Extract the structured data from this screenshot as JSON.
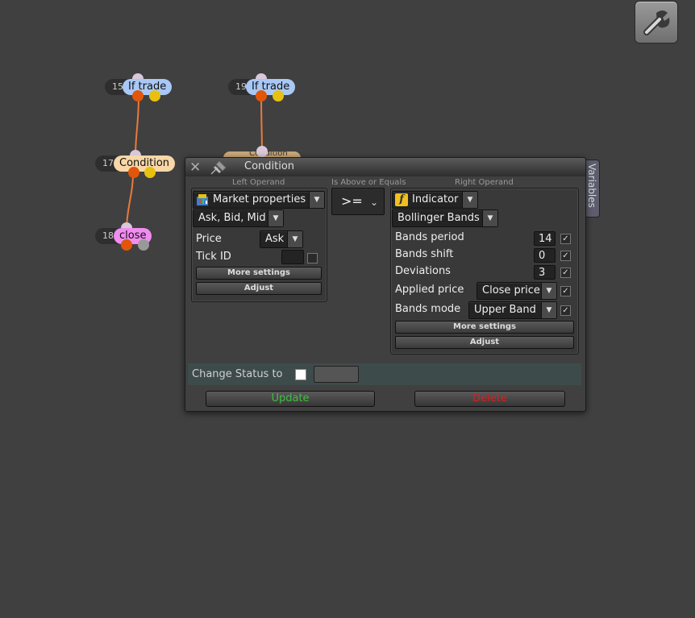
{
  "nodes": [
    {
      "id": "15",
      "label": "If trade"
    },
    {
      "id": "19",
      "label": "If trade"
    },
    {
      "id": "17",
      "label": "Condition"
    },
    {
      "id": "18",
      "label": "close"
    }
  ],
  "hidden_node_label": "Condition",
  "dialog": {
    "title": "Condition",
    "variables_tab": "Variables",
    "left": {
      "caption": "Left Operand",
      "type": "Market properties",
      "subtype": "Ask, Bid, Mid",
      "params": [
        {
          "label": "Price",
          "value": "Ask"
        },
        {
          "label": "Tick ID",
          "value": ""
        }
      ],
      "more_settings": "More settings",
      "adjust": "Adjust"
    },
    "operator": {
      "caption": "Is Above or Equals",
      "value": ">="
    },
    "right": {
      "caption": "Right Operand",
      "type": "Indicator",
      "subtype": "Bollinger Bands",
      "params": [
        {
          "label": "Bands period",
          "value": "14"
        },
        {
          "label": "Bands shift",
          "value": "0"
        },
        {
          "label": "Deviations",
          "value": "3"
        },
        {
          "label": "Applied price",
          "value": "Close price"
        },
        {
          "label": "Bands mode",
          "value": "Upper Band"
        }
      ],
      "more_settings": "More settings",
      "adjust": "Adjust"
    },
    "change_status_label": "Change Status to",
    "update_label": "Update",
    "delete_label": "Delete"
  },
  "colors": {
    "if_trade": "#a9c8f5",
    "condition": "#f8d7a8",
    "close": "#f18cf0",
    "update": "#3fbf3f",
    "delete": "#e01b1b"
  },
  "icons": [
    "wrench-icon",
    "close-icon",
    "pin-icon",
    "market-properties-icon",
    "function-icon",
    "chevron-down-icon",
    "check-icon"
  ]
}
